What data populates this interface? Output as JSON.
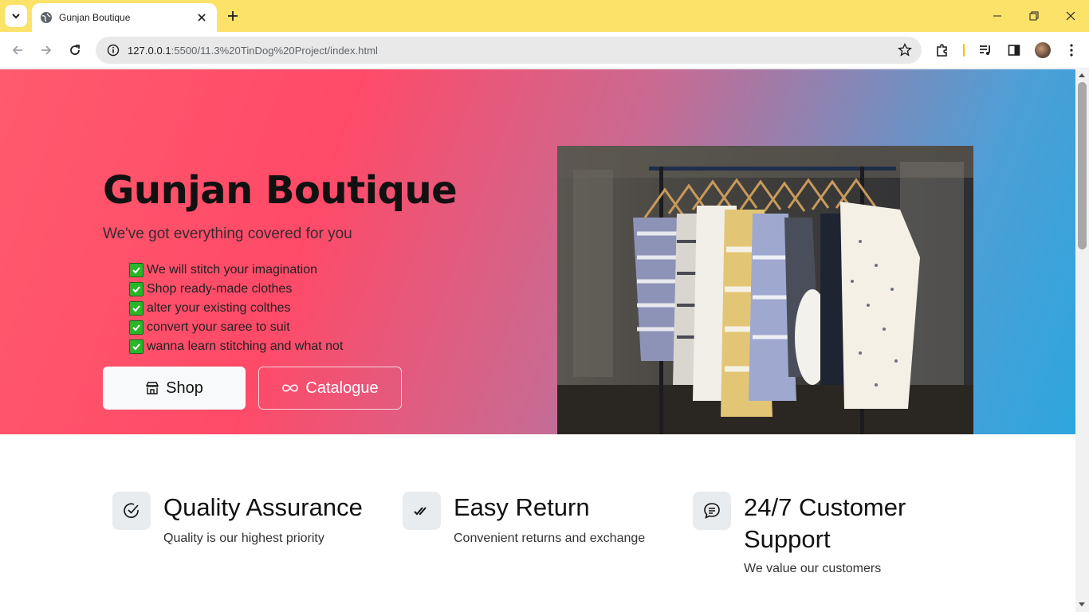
{
  "browser": {
    "tab_title": "Gunjan Boutique",
    "url_host": "127.0.0.1",
    "url_rest": ":5500/11.3%20TinDog%20Project/index.html"
  },
  "hero": {
    "title": "Gunjan Boutique",
    "subtitle": "We've got everything covered for you",
    "features": [
      "We will stitch your imagination",
      "Shop ready-made clothes",
      "alter your existing colthes",
      "convert your saree to suit",
      "wanna learn stitching and what not"
    ],
    "shop_label": "Shop",
    "catalogue_label": "Catalogue"
  },
  "features": [
    {
      "title": "Quality Assurance",
      "text": "Quality is our highest priority",
      "icon": "check-circle-icon"
    },
    {
      "title": "Easy Return",
      "text": "Convenient returns and exchange",
      "icon": "double-check-icon"
    },
    {
      "title": "24/7 Customer Support",
      "text": "We value our customers",
      "icon": "chat-icon"
    }
  ],
  "colors": {
    "tabstrip": "#fde26a",
    "hero_start": "#ff5a6e",
    "hero_end": "#2ea6de",
    "check_green": "#2bb52b"
  }
}
